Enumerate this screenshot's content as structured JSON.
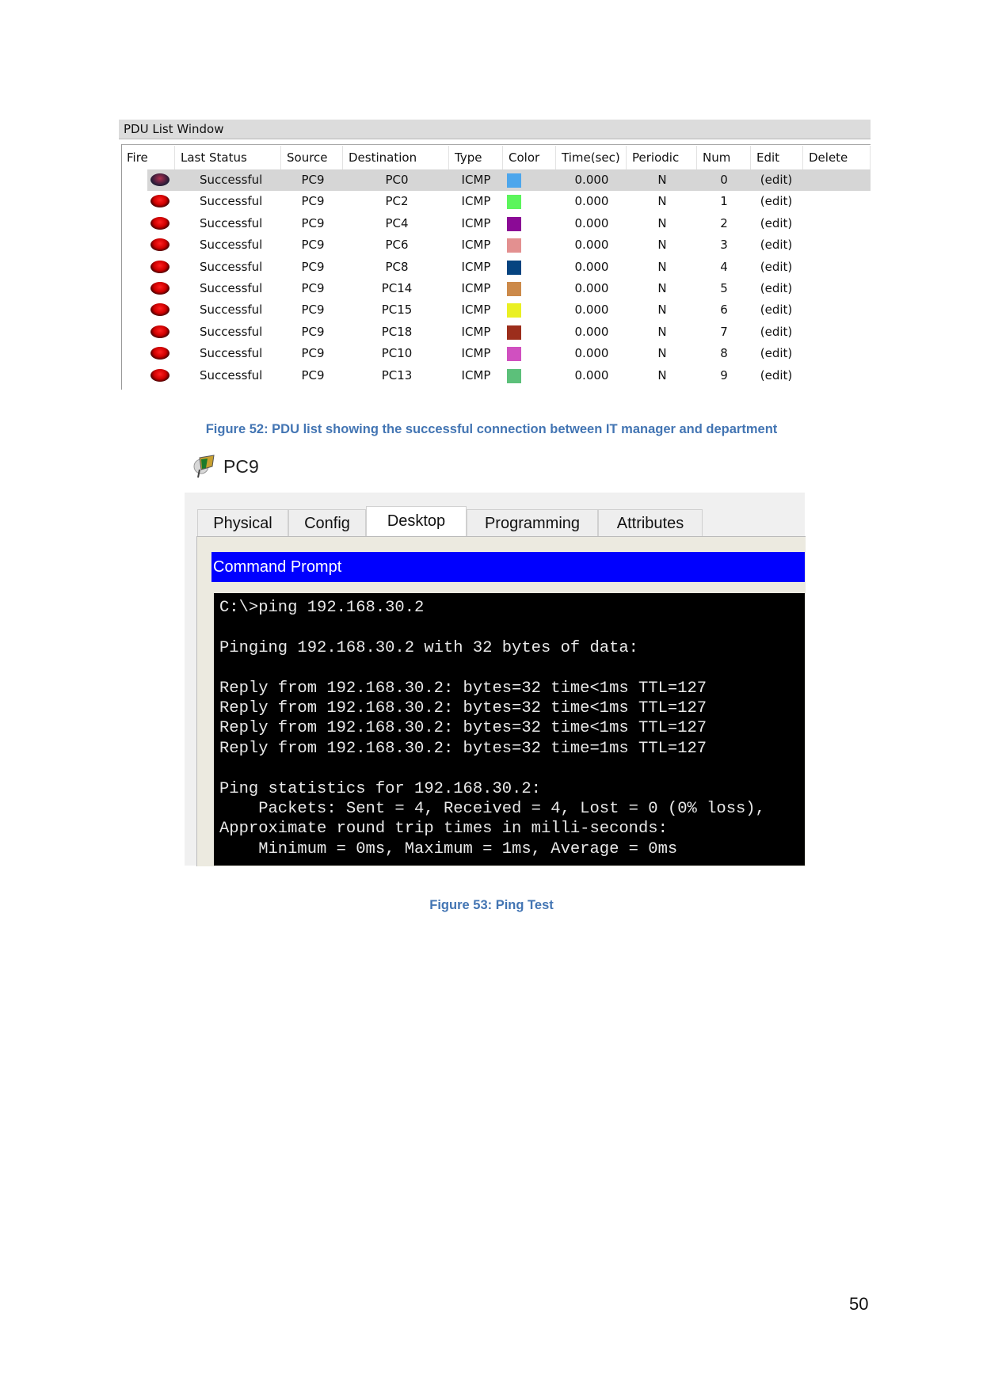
{
  "pdu_window": {
    "title": "PDU List Window",
    "columns": [
      "Fire",
      "Last Status",
      "Source",
      "Destination",
      "Type",
      "Color",
      "Time(sec)",
      "Periodic",
      "Num",
      "Edit",
      "Delete"
    ],
    "rows": [
      {
        "status": "Successful",
        "source": "PC9",
        "destination": "PC0",
        "type": "ICMP",
        "color": "#4da6ec",
        "time": "0.000",
        "periodic": "N",
        "num": "0",
        "edit": "(edit)",
        "selected": true
      },
      {
        "status": "Successful",
        "source": "PC9",
        "destination": "PC2",
        "type": "ICMP",
        "color": "#5cf55c",
        "time": "0.000",
        "periodic": "N",
        "num": "1",
        "edit": "(edit)"
      },
      {
        "status": "Successful",
        "source": "PC9",
        "destination": "PC4",
        "type": "ICMP",
        "color": "#8b0a96",
        "time": "0.000",
        "periodic": "N",
        "num": "2",
        "edit": "(edit)"
      },
      {
        "status": "Successful",
        "source": "PC9",
        "destination": "PC6",
        "type": "ICMP",
        "color": "#e39090",
        "time": "0.000",
        "periodic": "N",
        "num": "3",
        "edit": "(edit)"
      },
      {
        "status": "Successful",
        "source": "PC9",
        "destination": "PC8",
        "type": "ICMP",
        "color": "#064480",
        "time": "0.000",
        "periodic": "N",
        "num": "4",
        "edit": "(edit)"
      },
      {
        "status": "Successful",
        "source": "PC9",
        "destination": "PC14",
        "type": "ICMP",
        "color": "#cc8a4a",
        "time": "0.000",
        "periodic": "N",
        "num": "5",
        "edit": "(edit)"
      },
      {
        "status": "Successful",
        "source": "PC9",
        "destination": "PC15",
        "type": "ICMP",
        "color": "#eaf023",
        "time": "0.000",
        "periodic": "N",
        "num": "6",
        "edit": "(edit)"
      },
      {
        "status": "Successful",
        "source": "PC9",
        "destination": "PC18",
        "type": "ICMP",
        "color": "#9c2e1c",
        "time": "0.000",
        "periodic": "N",
        "num": "7",
        "edit": "(edit)"
      },
      {
        "status": "Successful",
        "source": "PC9",
        "destination": "PC10",
        "type": "ICMP",
        "color": "#d050c0",
        "time": "0.000",
        "periodic": "N",
        "num": "8",
        "edit": "(edit)"
      },
      {
        "status": "Successful",
        "source": "PC9",
        "destination": "PC13",
        "type": "ICMP",
        "color": "#5cc07a",
        "time": "0.000",
        "periodic": "N",
        "num": "9",
        "edit": "(edit)"
      }
    ]
  },
  "caption1": "Figure 52: PDU list showing the successful connection between IT manager and department",
  "pc_window": {
    "title": "PC9",
    "tabs": [
      "Physical",
      "Config",
      "Desktop",
      "Programming",
      "Attributes"
    ],
    "active_tab": "Desktop",
    "command_prompt_title": "Command Prompt",
    "terminal_lines": [
      "C:\\>ping 192.168.30.2",
      "",
      "Pinging 192.168.30.2 with 32 bytes of data:",
      "",
      "Reply from 192.168.30.2: bytes=32 time<1ms TTL=127",
      "Reply from 192.168.30.2: bytes=32 time<1ms TTL=127",
      "Reply from 192.168.30.2: bytes=32 time<1ms TTL=127",
      "Reply from 192.168.30.2: bytes=32 time=1ms TTL=127",
      "",
      "Ping statistics for 192.168.30.2:",
      "    Packets: Sent = 4, Received = 4, Lost = 0 (0% loss),",
      "Approximate round trip times in milli-seconds:",
      "    Minimum = 0ms, Maximum = 1ms, Average = 0ms"
    ]
  },
  "caption2": "Figure 53: Ping Test",
  "page_number": "50",
  "colors": {
    "caption": "#4375b3",
    "command_bar": "#0000ff",
    "terminal_bg": "#000000"
  }
}
